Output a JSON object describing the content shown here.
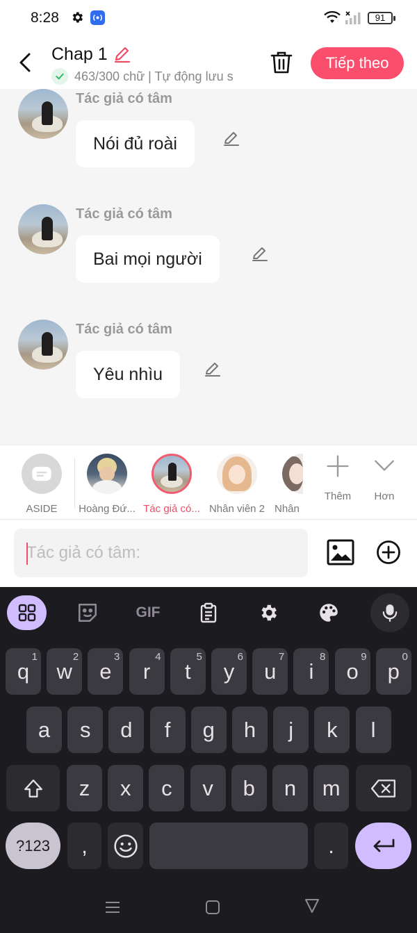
{
  "status_bar": {
    "time": "8:28",
    "battery": "91",
    "icons": [
      "gear-icon",
      "cast-icon",
      "wifi-icon",
      "signal-icon",
      "battery-icon"
    ]
  },
  "header": {
    "title": "Chap 1",
    "subtitle": "463/300 chữ | Tự động lưu s",
    "next_label": "Tiếp theo",
    "accent": "#fb4e6c"
  },
  "messages": [
    {
      "author": "Tác giả có tâm",
      "text": "Nói đủ roài"
    },
    {
      "author": "Tác giả có tâm",
      "text": "Bai mọi người"
    },
    {
      "author": "Tác giả có tâm",
      "text": "Yêu nhìu"
    }
  ],
  "characters": [
    {
      "label": "ASIDE",
      "active": false
    },
    {
      "label": "Hoàng Đứ...",
      "active": false
    },
    {
      "label": "Tác giả có...",
      "active": true
    },
    {
      "label": "Nhân viên 2",
      "active": false
    },
    {
      "label": "Nhân",
      "active": false
    }
  ],
  "tools": {
    "more_label": "Thêm",
    "expand_label": "Hơn"
  },
  "composer": {
    "placeholder": "Tác giả có tâm:"
  },
  "keyboard": {
    "toolbar": [
      "apps-icon",
      "sticker-icon",
      "GIF",
      "clipboard-icon",
      "settings-icon",
      "palette-icon",
      "mic-icon"
    ],
    "row1": [
      {
        "k": "q",
        "h": "1"
      },
      {
        "k": "w",
        "h": "2"
      },
      {
        "k": "e",
        "h": "3"
      },
      {
        "k": "r",
        "h": "4"
      },
      {
        "k": "t",
        "h": "5"
      },
      {
        "k": "y",
        "h": "6"
      },
      {
        "k": "u",
        "h": "7"
      },
      {
        "k": "i",
        "h": "8"
      },
      {
        "k": "o",
        "h": "9"
      },
      {
        "k": "p",
        "h": "0"
      }
    ],
    "row2": [
      "a",
      "s",
      "d",
      "f",
      "g",
      "h",
      "j",
      "k",
      "l"
    ],
    "row3": [
      "z",
      "x",
      "c",
      "v",
      "b",
      "n",
      "m"
    ],
    "num_label": "?123",
    "comma": ",",
    "period": "."
  }
}
